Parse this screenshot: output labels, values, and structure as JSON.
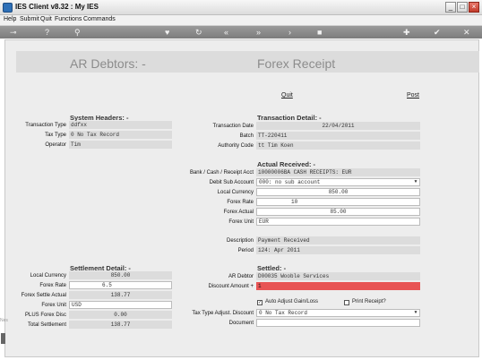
{
  "window": {
    "title": "IES Client v8.32 : My IES",
    "minimize_label": "_",
    "maximize_label": "□",
    "close_label": "×"
  },
  "menu": {
    "items": [
      "Help",
      "Submit",
      "Quit",
      "Functions",
      "Commands"
    ]
  },
  "toolbar": {
    "icons": [
      "key-icon",
      "help-icon",
      "search-icon",
      "heart-icon",
      "refresh-icon",
      "rewind-icon",
      "fast-forward-icon",
      "forward-icon",
      "stop-icon",
      "add-icon",
      "check-icon",
      "close-icon"
    ]
  },
  "page": {
    "title_left": "AR Debtors: -",
    "title_right": "Forex Receipt",
    "quit_link": "Quit",
    "post_link": "Post"
  },
  "system_headers": {
    "title": "System Headers: -",
    "transaction_type_label": "Transaction Type",
    "transaction_type_value": "ddfxx",
    "tax_type_label": "Tax Type",
    "tax_type_value": "0 No Tax Record",
    "operator_label": "Operator",
    "operator_value": "Tim"
  },
  "transaction_detail": {
    "title": "Transaction Detail: -",
    "date_label": "Transaction Date",
    "date_value": "22/04/2011",
    "batch_label": "Batch",
    "batch_value": "TT-220411",
    "authority_label": "Authority Code",
    "authority_value": "tt Tim Koen"
  },
  "actual_received": {
    "title": "Actual Received: -",
    "bank_label": "Bank / Cash / Receipt Acct",
    "bank_value": "10000006BA CASH RECEIPTS: EUR",
    "debit_sub_label": "Debit Sub Account",
    "debit_sub_value": "000: no sub account",
    "local_currency_label": "Local Currency",
    "local_currency_value": "850.00",
    "forex_rate_label": "Forex Rate",
    "forex_rate_value": "10",
    "forex_actual_label": "Forex Actual",
    "forex_actual_value": "85.00",
    "forex_unit_label": "Forex Unit",
    "forex_unit_value": "EUR",
    "description_label": "Description",
    "description_value": "Payment Received",
    "period_label": "Period",
    "period_value": "124: Apr 2011"
  },
  "settlement_detail": {
    "title": "Settlement Detail: -",
    "local_currency_label": "Local Currency",
    "local_currency_value": "850.00",
    "forex_rate_label": "Forex Rate",
    "forex_rate_value": "6.5",
    "forex_settle_label": "Forex Settle Actual",
    "forex_settle_value": "138.77",
    "forex_unit_label": "Forex Unit",
    "forex_unit_value": "USD",
    "plus_forex_disc_label": "PLUS Forex Disc",
    "plus_forex_disc_value": "0.00",
    "total_settlement_label": "Total Settlement",
    "total_settlement_value": "138.77"
  },
  "settled": {
    "title": "Settled: -",
    "ar_debtor_label": "AR Debtor",
    "ar_debtor_value": "D00035 Wooble Services",
    "discount_label": "Discount Amount +",
    "discount_value": "1",
    "auto_adjust_label": "Auto Adjust Gain/Loss",
    "auto_adjust_checked": true,
    "print_receipt_label": "Print Receipt?",
    "print_receipt_checked": false,
    "tax_adjust_label": "Tax Type Adjust. Discount",
    "tax_adjust_value": "0 No Tax Record",
    "document_label": "Document",
    "document_value": ""
  },
  "gutter": {
    "text": "Nes"
  }
}
